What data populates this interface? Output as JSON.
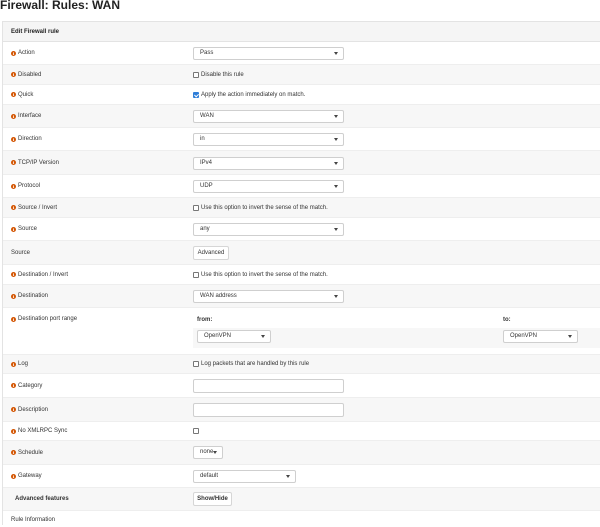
{
  "page": {
    "title": "Firewall: Rules: WAN"
  },
  "panel": {
    "heading": "Edit Firewall rule"
  },
  "fields": {
    "action": {
      "label": "Action",
      "value": "Pass"
    },
    "disabled": {
      "label": "Disabled",
      "checkbox_text": "Disable this rule",
      "checked": false
    },
    "quick": {
      "label": "Quick",
      "checkbox_text": "Apply the action immediately on match.",
      "checked": true
    },
    "interface": {
      "label": "Interface",
      "value": "WAN"
    },
    "direction": {
      "label": "Direction",
      "value": "in"
    },
    "tcpip_version": {
      "label": "TCP/IP Version",
      "value": "IPv4"
    },
    "protocol": {
      "label": "Protocol",
      "value": "UDP"
    },
    "source_invert": {
      "label": "Source / Invert",
      "checkbox_text": "Use this option to invert the sense of the match.",
      "checked": false
    },
    "source": {
      "label": "Source",
      "value": "any"
    },
    "source_adv": {
      "label": "Source",
      "button": "Advanced"
    },
    "destination_invert": {
      "label": "Destination / Invert",
      "checkbox_text": "Use this option to invert the sense of the match.",
      "checked": false
    },
    "destination": {
      "label": "Destination",
      "value": "WAN address"
    },
    "dest_port_range": {
      "label": "Destination port range",
      "from_label": "from:",
      "to_label": "to:",
      "from_value": "OpenVPN",
      "to_value": "OpenVPN"
    },
    "log": {
      "label": "Log",
      "checkbox_text": "Log packets that are handled by this rule",
      "checked": false
    },
    "category": {
      "label": "Category",
      "value": ""
    },
    "description": {
      "label": "Description",
      "value": ""
    },
    "no_xmlrpc_sync": {
      "label": "No XMLRPC Sync",
      "checked": false
    },
    "schedule": {
      "label": "Schedule",
      "value": "none"
    },
    "gateway": {
      "label": "Gateway",
      "value": "default"
    },
    "advanced_features": {
      "label": "Advanced features",
      "button": "Show/Hide"
    },
    "rule_information": {
      "label": "Rule Information"
    }
  },
  "colors": {
    "info_icon": "#d35400",
    "checkbox_checked": "#2f7ed8",
    "row_alt": "#f7f7f7"
  }
}
